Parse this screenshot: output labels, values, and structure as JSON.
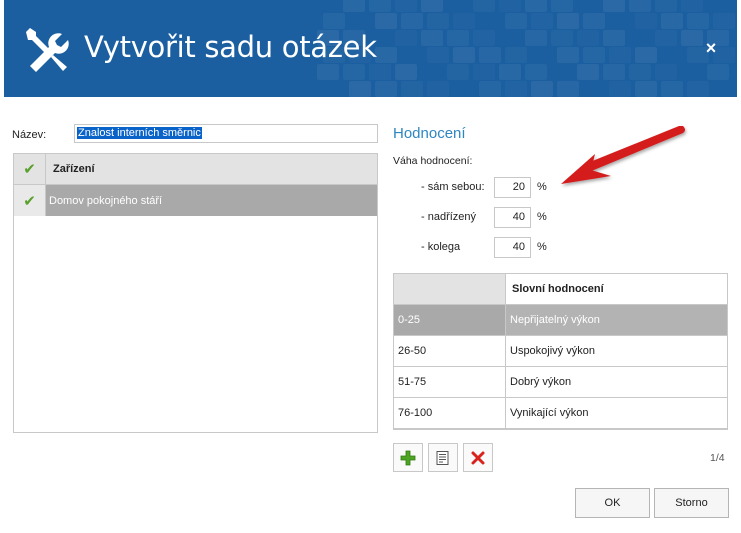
{
  "dialog": {
    "title": "Vytvořit sadu otázek",
    "close_label": "×"
  },
  "name": {
    "label": "Název:",
    "value": "Znalost interních směrnic"
  },
  "facilities": {
    "header": "Zařízení",
    "items": [
      {
        "label": "Domov pokojného stáří",
        "checked": true,
        "selected": true
      }
    ]
  },
  "rating": {
    "section_title": "Hodnocení",
    "weight_label": "Váha hodnocení:",
    "weights": [
      {
        "label": "- sám sebou:",
        "value": "20",
        "unit": "%"
      },
      {
        "label": "- nadřízený",
        "value": "40",
        "unit": "%"
      },
      {
        "label": "- kolega",
        "value": "40",
        "unit": "%"
      }
    ],
    "table": {
      "headers": [
        "",
        "Slovní hodnocení"
      ],
      "rows": [
        {
          "range": "0-25",
          "text": "Nepřijatelný výkon",
          "selected": true
        },
        {
          "range": "26-50",
          "text": "Uspokojivý výkon",
          "selected": false
        },
        {
          "range": "51-75",
          "text": "Dobrý výkon",
          "selected": false
        },
        {
          "range": "76-100",
          "text": "Vynikající výkon",
          "selected": false
        }
      ]
    },
    "pager": "1/4",
    "toolbar_icons": [
      "add-icon",
      "edit-icon",
      "delete-icon"
    ]
  },
  "buttons": {
    "ok": "OK",
    "cancel": "Storno"
  },
  "colors": {
    "header_bg": "#1b5fa0",
    "accent": "#2e86c1",
    "check": "#5aa02c",
    "delete": "#d9221c",
    "annotation_arrow": "#d41b1b"
  }
}
